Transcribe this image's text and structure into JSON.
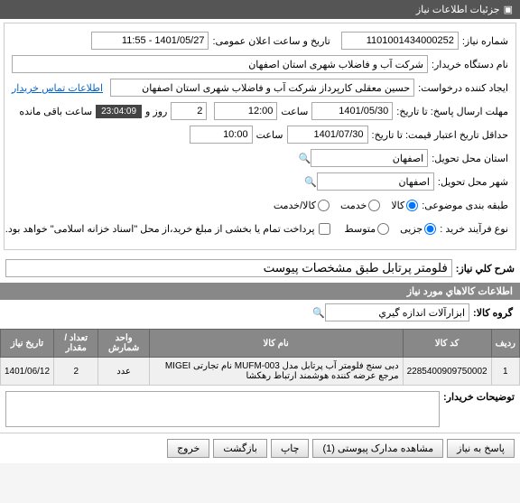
{
  "header": {
    "title": "جزئیات اطلاعات نیاز"
  },
  "fields": {
    "need_no_label": "شماره نیاز:",
    "need_no": "1101001434000252",
    "announce_label": "تاریخ و ساعت اعلان عمومی:",
    "announce": "1401/05/27 - 11:55",
    "buyer_label": "نام دستگاه خریدار:",
    "buyer": "شرکت آب و فاضلاب شهری استان اصفهان",
    "creator_label": "ایجاد کننده درخواست:",
    "creator": "حسین معقلی کارپرداز شرکت آب و فاضلاب شهری استان اصفهان",
    "contact_link": "اطلاعات تماس خریدار",
    "deadline_label": "مهلت ارسال پاسخ: تا تاریخ:",
    "deadline_date": "1401/05/30",
    "time_label": "ساعت",
    "deadline_time": "12:00",
    "and_label": "روز و",
    "days": "2",
    "remaining_time": "23:04:09",
    "remaining_suffix": "ساعت باقی مانده",
    "validity_label": "حداقل تاریخ اعتبار قیمت: تا تاریخ:",
    "validity_date": "1401/07/30",
    "validity_time": "10:00",
    "province_label": "استان محل تحویل:",
    "province": "اصفهان",
    "city_label": "شهر محل تحویل:",
    "city": "اصفهان",
    "category_label": "طبقه بندی موضوعی:",
    "cat_goods": "کالا",
    "cat_service": "خدمت",
    "cat_both": "کالا/خدمت",
    "process_label": "نوع فرآیند خرید :",
    "proc_small": "جزیی",
    "proc_medium": "متوسط",
    "payment_note": "پرداخت تمام یا بخشی از مبلغ خرید،از محل \"اسناد خزانه اسلامی\" خواهد بود."
  },
  "desc": {
    "title_label": "شرح کلي نياز:",
    "title": "فلومتر پرتابل طبق مشخصات پیوست"
  },
  "goods": {
    "section": "اطلاعات کالاهاي مورد نياز",
    "group_label": "گروه کالا:",
    "group": "ابزارآلات اندازه گيري",
    "cols": {
      "row": "ردیف",
      "code": "کد کالا",
      "name": "نام کالا",
      "unit": "واحد شمارش",
      "qty": "تعداد / مقدار",
      "date": "تاریخ نیاز"
    },
    "items": [
      {
        "row": "1",
        "code": "2285400909750002",
        "name": "دبی سنج فلومتر آب پرتابل مدل MUFM-003 نام تجارتی MIGEI مرجع عرضه کننده هوشمند ارتباط رهکشا",
        "unit": "عدد",
        "qty": "2",
        "date": "1401/06/12"
      }
    ]
  },
  "notes": {
    "label": "توضیحات خریدار:"
  },
  "buttons": {
    "reply": "پاسخ به نیاز",
    "attach": "مشاهده مدارک پیوستی (1)",
    "print": "چاپ",
    "back": "بازگشت",
    "exit": "خروج"
  }
}
